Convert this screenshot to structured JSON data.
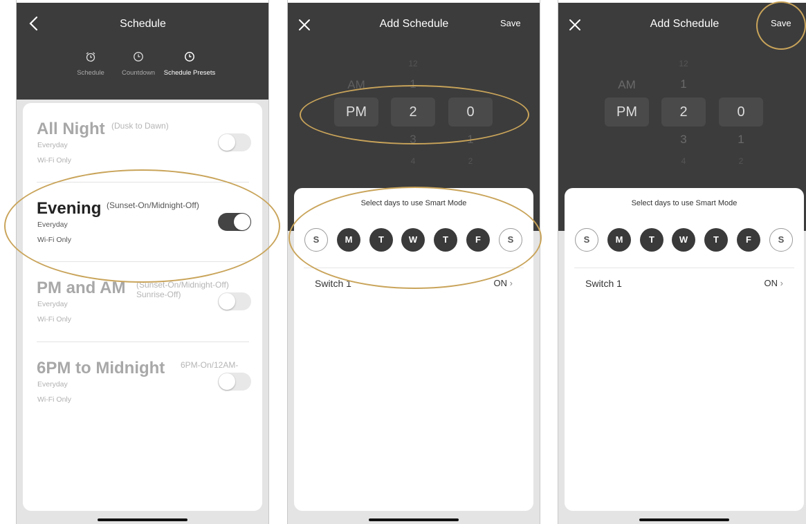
{
  "screen1": {
    "title": "Schedule",
    "tabs": [
      {
        "label": "Schedule",
        "icon": "alarm-clock-icon"
      },
      {
        "label": "Countdown",
        "icon": "clock-icon"
      },
      {
        "label": "Schedule Presets",
        "icon": "clock-icon"
      }
    ],
    "presets": [
      {
        "name": "All Night",
        "detail": "(Dusk to Dawn)",
        "days": "Everyday",
        "mode": "Wi-Fi Only",
        "enabled": false
      },
      {
        "name": "Evening",
        "detail": "(Sunset-On/Midnight-Off)",
        "days": "Everyday",
        "mode": "Wi-Fi Only",
        "enabled": true
      },
      {
        "name": "PM and AM",
        "detail": "(Sunset-On/Midnight-Off)\nSunrise-Off)",
        "days": "Everyday",
        "mode": "Wi-Fi Only",
        "enabled": false
      },
      {
        "name": "6PM to Midnight",
        "detail": "6PM-On/12AM-",
        "days": "Everyday",
        "mode": "Wi-Fi Only",
        "enabled": false
      }
    ]
  },
  "screen2": {
    "title": "Add Schedule",
    "save_label": "Save",
    "picker": {
      "ampm_above": "AM",
      "ampm": "PM",
      "hour_above2": "12",
      "hour_above": "1",
      "hour": "2",
      "hour_below": "3",
      "hour_below2": "4",
      "minute": "0",
      "minute_below": "1",
      "minute_below2": "2"
    },
    "days_title": "Select days to use Smart Mode",
    "days": [
      {
        "label": "S",
        "selected": false
      },
      {
        "label": "M",
        "selected": true
      },
      {
        "label": "T",
        "selected": true
      },
      {
        "label": "W",
        "selected": true
      },
      {
        "label": "T",
        "selected": true
      },
      {
        "label": "F",
        "selected": true
      },
      {
        "label": "S",
        "selected": false
      }
    ],
    "switch_label": "Switch 1",
    "switch_value": "ON"
  },
  "screen3": {
    "title": "Add Schedule",
    "save_label": "Save",
    "picker": {
      "ampm_above": "AM",
      "ampm": "PM",
      "hour_above2": "12",
      "hour_above": "1",
      "hour": "2",
      "hour_below": "3",
      "hour_below2": "4",
      "minute": "0",
      "minute_below": "1",
      "minute_below2": "2"
    },
    "days_title": "Select days to use Smart Mode",
    "days": [
      {
        "label": "S",
        "selected": false
      },
      {
        "label": "M",
        "selected": true
      },
      {
        "label": "T",
        "selected": true
      },
      {
        "label": "W",
        "selected": true
      },
      {
        "label": "T",
        "selected": true
      },
      {
        "label": "F",
        "selected": true
      },
      {
        "label": "S",
        "selected": false
      }
    ],
    "switch_label": "Switch 1",
    "switch_value": "ON"
  },
  "colors": {
    "dark_header": "#3c3c3c",
    "highlight": "#c9a45a",
    "toggle_on": "#444444"
  }
}
